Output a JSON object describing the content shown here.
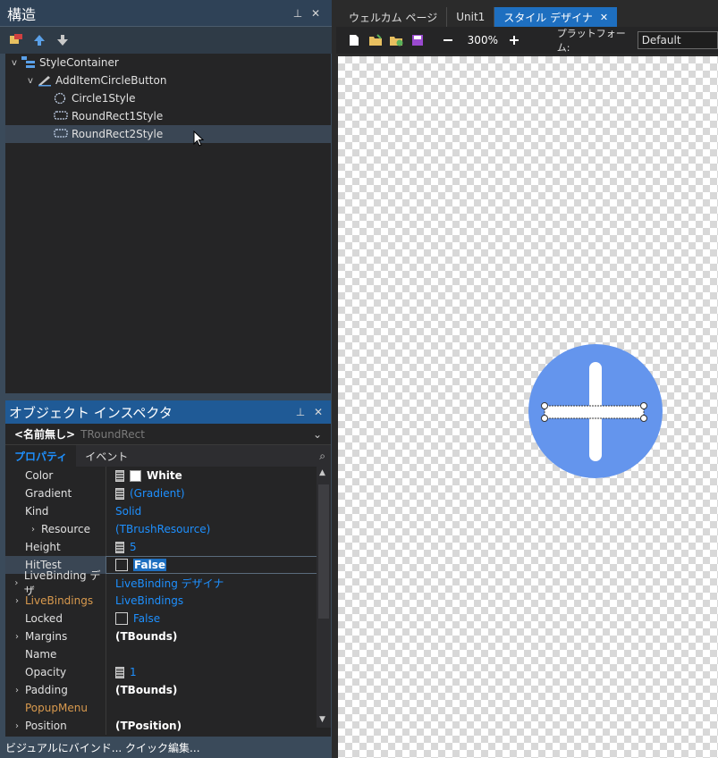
{
  "structure": {
    "title": "構造",
    "tree": [
      {
        "label": "StyleContainer",
        "level": 0,
        "expanded": true
      },
      {
        "label": "AddItemCircleButton",
        "level": 1,
        "expanded": true
      },
      {
        "label": "Circle1Style",
        "level": 2
      },
      {
        "label": "RoundRect1Style",
        "level": 2
      },
      {
        "label": "RoundRect2Style",
        "level": 2,
        "selected": true
      }
    ]
  },
  "inspector": {
    "title": "オブジェクト インスペクタ",
    "object_name": "<名前無し>",
    "object_type": "TRoundRect",
    "tabs": [
      "プロパティ",
      "イベント"
    ],
    "properties": [
      {
        "name": "Color",
        "value": "White"
      },
      {
        "name": "Gradient",
        "value": "(Gradient)"
      },
      {
        "name": "Kind",
        "value": "Solid"
      },
      {
        "name": "Resource",
        "value": "(TBrushResource)"
      },
      {
        "name": "Height",
        "value": "5"
      },
      {
        "name": "HitTest",
        "value": "False"
      },
      {
        "name": "LiveBinding デザ",
        "value": "LiveBinding デザイナ"
      },
      {
        "name": "LiveBindings",
        "value": "LiveBindings"
      },
      {
        "name": "Locked",
        "value": "False"
      },
      {
        "name": "Margins",
        "value": "(TBounds)"
      },
      {
        "name": "Name",
        "value": ""
      },
      {
        "name": "Opacity",
        "value": "1"
      },
      {
        "name": "Padding",
        "value": "(TBounds)"
      },
      {
        "name": "PopupMenu",
        "value": ""
      },
      {
        "name": "Position",
        "value": "(TPosition)"
      }
    ]
  },
  "bottom_bar": {
    "text": "ビジュアルにバインド... クイック編集..."
  },
  "doc_tabs": [
    "ウェルカム ページ",
    "Unit1",
    "スタイル デザイナ"
  ],
  "designer": {
    "zoom": "300%",
    "platform_label": "プラットフォーム:",
    "platform_value": "Default"
  },
  "colors": {
    "accent": "#1e6fc0",
    "circle": "#6495ed"
  }
}
